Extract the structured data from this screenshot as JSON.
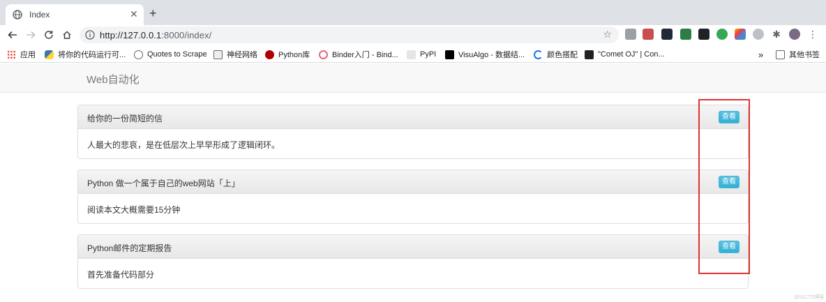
{
  "browser": {
    "tab": {
      "title": "Index",
      "close_glyph": "✕"
    },
    "new_tab_glyph": "+",
    "url": {
      "host": "http://127.0.0.1",
      "rest": ":8000/index/"
    },
    "bookmarks": [
      {
        "label": "应用",
        "icon": "apps-grid-icon",
        "color": "#e94335"
      },
      {
        "label": "将你的代码运行可...",
        "icon": "python-icon",
        "color": "#3d77a8"
      },
      {
        "label": "Quotes to Scrape",
        "icon": "globe-icon",
        "color": "#5f6368"
      },
      {
        "label": "神经网络",
        "icon": "neural-net-icon",
        "color": "#666666"
      },
      {
        "label": "Python库",
        "icon": "python-lib-icon",
        "color": "#b00000"
      },
      {
        "label": "Binder入门 - Bind...",
        "icon": "binder-icon",
        "color": "#e66581"
      },
      {
        "label": "PyPI",
        "icon": "pypi-icon",
        "color": "#e5e5e5"
      },
      {
        "label": "VisuAlgo - 数据结...",
        "icon": "visualgo-icon",
        "color": "#000000"
      },
      {
        "label": "颜色搭配",
        "icon": "color-c-icon",
        "color": "#1a73e8"
      },
      {
        "label": "\"Comet OJ\" | Con...",
        "icon": "comet-oj-icon",
        "color": "#222222"
      }
    ],
    "bookmarks_overflow": "»",
    "other_bookmarks": "其他书签"
  },
  "page": {
    "brand": "Web自动化",
    "panels": [
      {
        "title": "给你的一份简短的信",
        "button": "查看",
        "body": "人最大的悲哀，是在低层次上早早形成了逻辑闭环。"
      },
      {
        "title": "Python 做一个属于自己的web网站「上」",
        "button": "查看",
        "body": "阅读本文大概需要15分钟"
      },
      {
        "title": "Python邮件的定期报告",
        "button": "查看",
        "body": "首先准备代码部分"
      }
    ],
    "watermark": "@51CTO博客"
  },
  "colors": {
    "accent_button": "#5bc0de",
    "highlight": "#e0312f"
  }
}
